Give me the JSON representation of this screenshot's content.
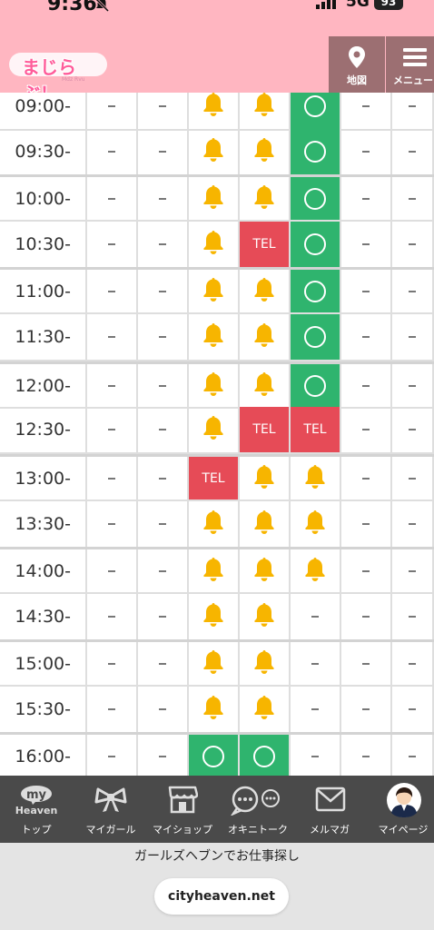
{
  "status_bar": {
    "time": "9:36",
    "network": "5G",
    "battery": "93"
  },
  "header": {
    "logo_text": "まじらぶ！",
    "logo_subtext": "Mdz Rvu",
    "map_label": "地図",
    "menu_label": "メニュー"
  },
  "schedule": {
    "rows": [
      {
        "time": "09:00-",
        "cells": [
          "dash",
          "dash",
          "bell",
          "bell",
          "circle",
          "dash",
          "dash"
        ]
      },
      {
        "time": "09:30-",
        "cells": [
          "dash",
          "dash",
          "bell",
          "bell",
          "circle",
          "dash",
          "dash"
        ]
      },
      {
        "time": "10:00-",
        "cells": [
          "dash",
          "dash",
          "bell",
          "bell",
          "circle",
          "dash",
          "dash"
        ]
      },
      {
        "time": "10:30-",
        "cells": [
          "dash",
          "dash",
          "bell",
          "tel",
          "circle",
          "dash",
          "dash"
        ]
      },
      {
        "time": "11:00-",
        "cells": [
          "dash",
          "dash",
          "bell",
          "bell",
          "circle",
          "dash",
          "dash"
        ]
      },
      {
        "time": "11:30-",
        "cells": [
          "dash",
          "dash",
          "bell",
          "bell",
          "circle",
          "dash",
          "dash"
        ]
      },
      {
        "time": "12:00-",
        "cells": [
          "dash",
          "dash",
          "bell",
          "bell",
          "circle",
          "dash",
          "dash"
        ]
      },
      {
        "time": "12:30-",
        "cells": [
          "dash",
          "dash",
          "bell",
          "tel",
          "tel",
          "dash",
          "dash"
        ]
      },
      {
        "time": "13:00-",
        "cells": [
          "dash",
          "dash",
          "tel",
          "bell",
          "bell",
          "dash",
          "dash"
        ]
      },
      {
        "time": "13:30-",
        "cells": [
          "dash",
          "dash",
          "bell",
          "bell",
          "bell",
          "dash",
          "dash"
        ]
      },
      {
        "time": "14:00-",
        "cells": [
          "dash",
          "dash",
          "bell",
          "bell",
          "bell",
          "dash",
          "dash"
        ]
      },
      {
        "time": "14:30-",
        "cells": [
          "dash",
          "dash",
          "bell",
          "bell",
          "dash",
          "dash",
          "dash"
        ]
      },
      {
        "time": "15:00-",
        "cells": [
          "dash",
          "dash",
          "bell",
          "bell",
          "dash",
          "dash",
          "dash"
        ]
      },
      {
        "time": "15:30-",
        "cells": [
          "dash",
          "dash",
          "bell",
          "bell",
          "dash",
          "dash",
          "dash"
        ]
      },
      {
        "time": "16:00-",
        "cells": [
          "dash",
          "dash",
          "circle",
          "circle",
          "dash",
          "dash",
          "dash"
        ]
      }
    ],
    "tel_label": "TEL",
    "colors": {
      "available": "#2fb46e",
      "tel": "#e64b57",
      "bell": "#f7b500"
    }
  },
  "tabbar": {
    "items": [
      {
        "id": "top",
        "label": "トップ",
        "badge_top": "my",
        "badge_bottom": "Heaven",
        "icon": "my-heaven-icon"
      },
      {
        "id": "mygirl",
        "label": "マイガール",
        "icon": "ribbon-icon"
      },
      {
        "id": "myshop",
        "label": "マイショップ",
        "icon": "shop-icon"
      },
      {
        "id": "okinitalk",
        "label": "オキニトーク",
        "icon": "chat-bubbles-icon"
      },
      {
        "id": "melmaga",
        "label": "メルマガ",
        "icon": "mail-icon"
      },
      {
        "id": "mypage",
        "label": "マイページ",
        "icon": "avatar-icon"
      }
    ]
  },
  "browser": {
    "caption": "ガールズヘブンでお仕事探し",
    "url": "cityheaven.net"
  }
}
